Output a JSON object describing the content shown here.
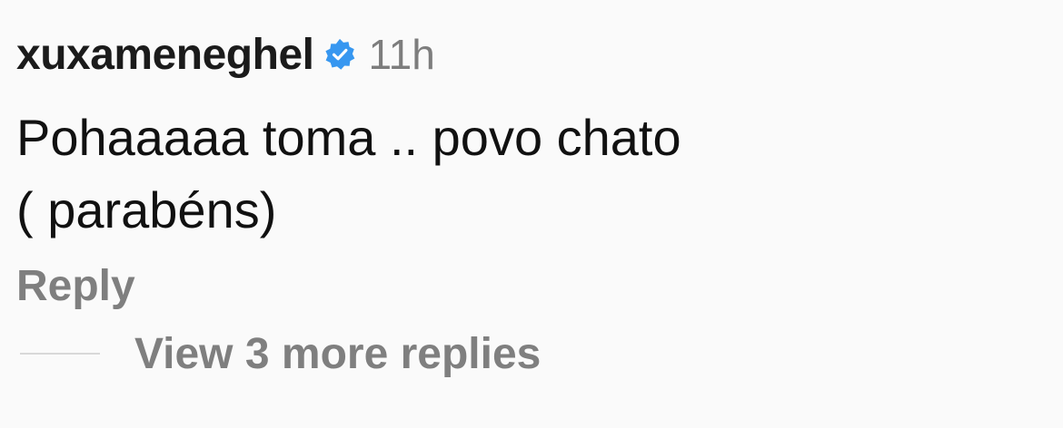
{
  "comment": {
    "username": "xuxameneghel",
    "verified_icon": "verified-badge-icon",
    "timestamp": "11h",
    "text": "Pohaaaaa toma .. povo chato\n( parabéns)",
    "reply_label": "Reply",
    "view_more_label": "View 3 more replies"
  },
  "colors": {
    "verified_badge": "#3797f0",
    "secondary_text": "#7f7f7f",
    "primary_text": "#111111",
    "background": "#fafafa"
  }
}
